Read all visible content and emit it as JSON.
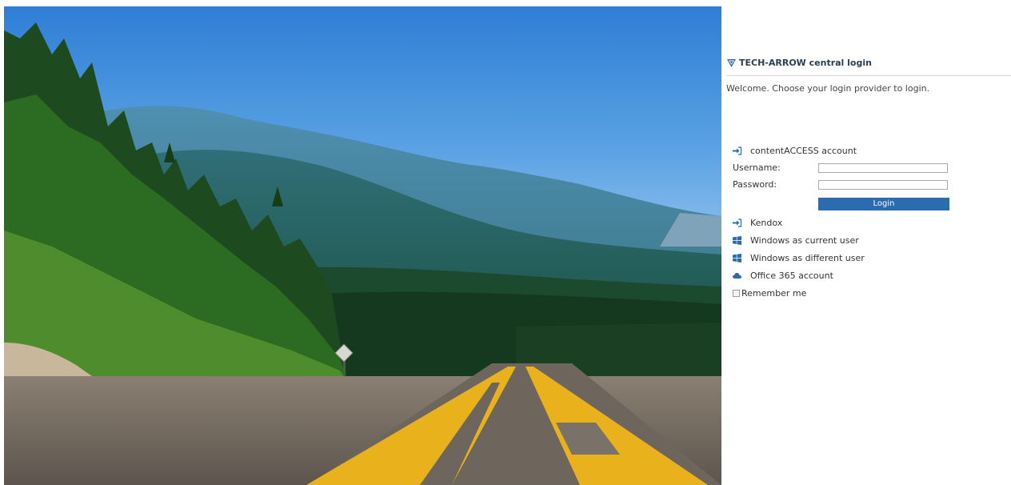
{
  "header": {
    "title": "TECH-ARROW central login",
    "logo_icon": "tech-arrow-logo-icon"
  },
  "welcome_text": "Welcome. Choose your login provider to login.",
  "content_access": {
    "label": "contentACCESS account",
    "icon": "sign-in-icon",
    "username_label": "Username:",
    "username_value": "",
    "password_label": "Password:",
    "password_value": "",
    "login_button": "Login"
  },
  "providers": [
    {
      "label": "Kendox",
      "icon": "sign-in-icon"
    },
    {
      "label": "Windows as current user",
      "icon": "windows-icon"
    },
    {
      "label": "Windows as different user",
      "icon": "windows-icon"
    },
    {
      "label": "Office 365 account",
      "icon": "cloud-icon"
    }
  ],
  "remember_me": {
    "label": "Remember me",
    "checked": false
  },
  "colors": {
    "accent": "#2b6cb0",
    "icon_blue": "#2f6aa6",
    "header_text": "#2b3e50",
    "road_line": "#e9b21c"
  }
}
